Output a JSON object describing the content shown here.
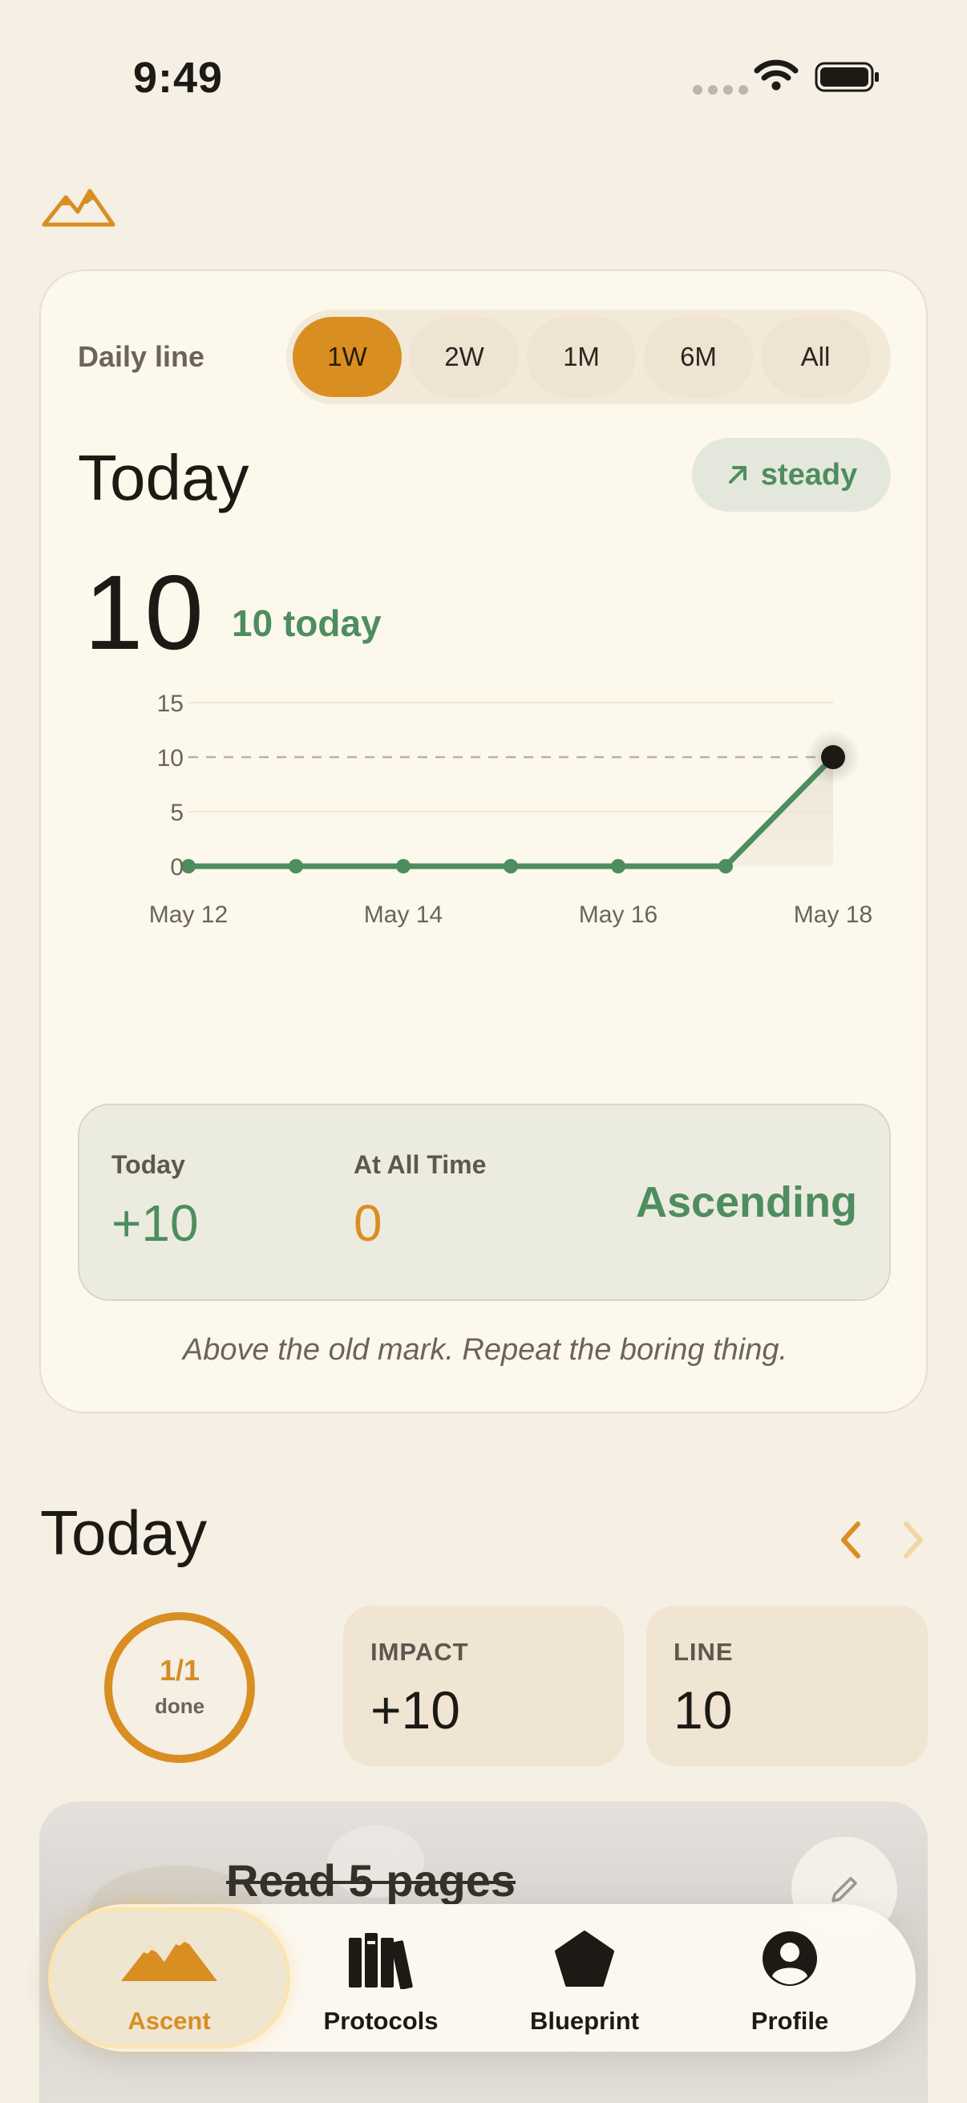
{
  "status": {
    "time": "9:49"
  },
  "card": {
    "range_label": "Daily line",
    "ranges": [
      "1W",
      "2W",
      "1M",
      "6M",
      "All"
    ],
    "active_range": "1W",
    "title": "Today",
    "trend": "steady",
    "value": "10",
    "value_sub": "10 today",
    "stats": {
      "today_label": "Today",
      "today_value": "+10",
      "alltime_label": "At All Time",
      "alltime_value": "0",
      "state": "Ascending"
    },
    "quote": "Above the old mark. Repeat the boring thing."
  },
  "chart_data": {
    "type": "line",
    "x": [
      "May 12",
      "May 13",
      "May 14",
      "May 15",
      "May 16",
      "May 17",
      "May 18"
    ],
    "x_tick_labels": [
      "May 12",
      "May 14",
      "May 16",
      "May 18"
    ],
    "values": [
      0,
      0,
      0,
      0,
      0,
      0,
      10
    ],
    "y_ticks": [
      0,
      5,
      10,
      15
    ],
    "ylim": [
      0,
      15
    ],
    "reference_line": 10,
    "grid": true,
    "colors": {
      "line": "#4e8d5e",
      "highlight": "#1d1a15"
    }
  },
  "today": {
    "title": "Today",
    "ring_value": "1/1",
    "ring_label": "done",
    "ring_progress": 1,
    "impact_label": "IMPACT",
    "impact_value": "+10",
    "line_label": "LINE",
    "line_value": "10"
  },
  "habit": {
    "title": "Read 5 pages"
  },
  "tabs": [
    {
      "label": "Ascent",
      "icon": "mountains-icon",
      "active": true
    },
    {
      "label": "Protocols",
      "icon": "books-icon",
      "active": false
    },
    {
      "label": "Blueprint",
      "icon": "pentagon-icon",
      "active": false
    },
    {
      "label": "Profile",
      "icon": "person-icon",
      "active": false
    }
  ],
  "colors": {
    "accent": "#d98e22",
    "positive": "#4e8d5e",
    "background": "#f5efe4"
  }
}
